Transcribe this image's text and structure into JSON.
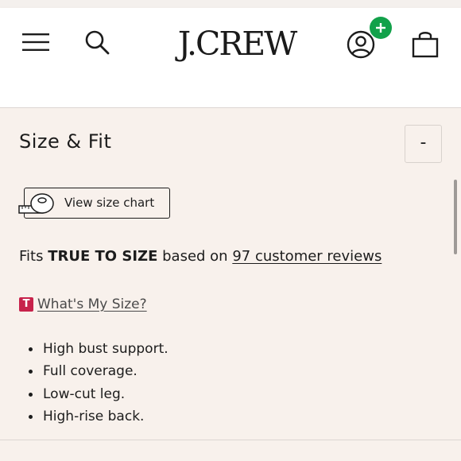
{
  "header": {
    "logo": "J.CREW",
    "menu_icon": "hamburger-menu-icon",
    "search_icon": "search-icon",
    "account_icon": "account-icon",
    "bag_icon": "shopping-bag-icon",
    "badge_color": "#12a14a"
  },
  "size_fit": {
    "title": "Size & Fit",
    "collapse_label": "-",
    "size_chart_label": "View size chart",
    "fit_prefix": "Fits ",
    "fit_value": "TRUE TO SIZE",
    "fit_mid": " based on ",
    "reviews_link": "97 customer reviews",
    "whats_my_size_badge": "T",
    "whats_my_size_link": "What's My Size?",
    "badge_color": "#c7224b",
    "bullets": [
      "High bust support.",
      "Full coverage.",
      "Low-cut leg.",
      "High-rise back."
    ]
  }
}
